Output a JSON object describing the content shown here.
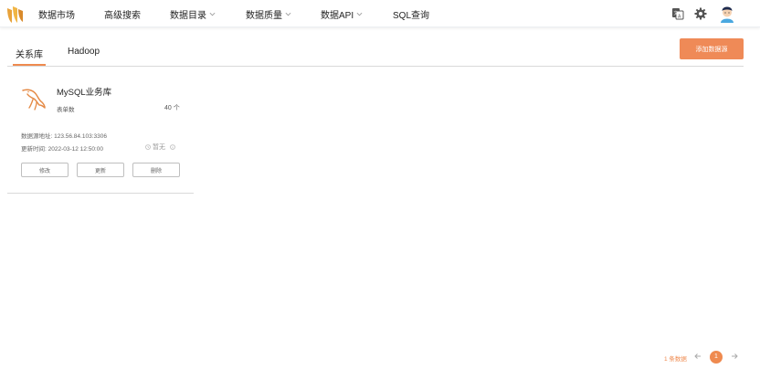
{
  "nav": {
    "items": [
      {
        "label": "数据市场"
      },
      {
        "label": "高级搜索"
      },
      {
        "label": "数据目录"
      },
      {
        "label": "数据质量"
      },
      {
        "label": "数据API"
      },
      {
        "label": "SQL查询"
      }
    ]
  },
  "tabs": [
    {
      "label": "关系库",
      "active": true
    },
    {
      "label": "Hadoop",
      "active": false
    }
  ],
  "add_button": "添加数据源",
  "card": {
    "title": "MySQL业务库",
    "table_count_label": "表单数",
    "table_count_value": "40 个",
    "address": "数据源地址: 123.56.84.103:3306",
    "updated": "更新时间: 2022-03-12 12:50:00",
    "status": "暂无",
    "buttons": {
      "edit": "修改",
      "update": "更新",
      "delete": "删除"
    }
  },
  "pagination": {
    "total": "1 条数据",
    "current_page": "1"
  },
  "colors": {
    "accent": "#ef8a4f"
  },
  "icons": [
    "logo-icon",
    "translate-icon",
    "gear-icon",
    "avatar",
    "mysql-dolphin-icon",
    "clock-icon",
    "info-icon",
    "arrow-left-icon",
    "arrow-right-icon"
  ]
}
